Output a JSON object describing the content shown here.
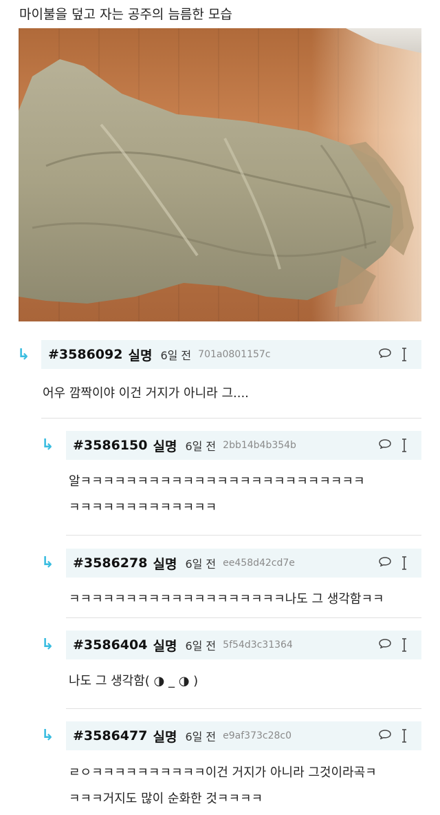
{
  "post": {
    "title": "마이불을 덮고 자는 공주의 늠름한 모습"
  },
  "comments": [
    {
      "number": "#3586092",
      "author": "실명",
      "time": "6일 전",
      "hash": "701a0801157c",
      "lines": [
        "어우 깜짝이야 이건 거지가 아니라 그...."
      ]
    },
    {
      "number": "#3586150",
      "author": "실명",
      "time": "6일 전",
      "hash": "2bb14b4b354b",
      "lines": [
        "알ㅋㅋㅋㅋㅋㅋㅋㅋㅋㅋㅋㅋㅋㅋㅋㅋㅋㅋㅋㅋㅋㅋㅋㅋㅋ",
        "ㅋㅋㅋㅋㅋㅋㅋㅋㅋㅋㅋㅋㅋ"
      ]
    },
    {
      "number": "#3586278",
      "author": "실명",
      "time": "6일 전",
      "hash": "ee458d42cd7e",
      "lines": [
        "ㅋㅋㅋㅋㅋㅋㅋㅋㅋㅋㅋㅋㅋㅋㅋㅋㅋㅋㅋ나도 그 생각함ㅋㅋ"
      ]
    },
    {
      "number": "#3586404",
      "author": "실명",
      "time": "6일 전",
      "hash": "5f54d3c31364",
      "lines": [
        "나도 그 생각함( ◑ _ ◑ )"
      ]
    },
    {
      "number": "#3586477",
      "author": "실명",
      "time": "6일 전",
      "hash": "e9af373c28c0",
      "lines": [
        "ㄹㅇㅋㅋㅋㅋㅋㅋㅋㅋㅋㅋ이건 거지가 아니라 그것이라곡ㅋ",
        "ㅋㅋㅋ거지도 많이 순화한 것ㅋㅋㅋㅋ"
      ]
    }
  ],
  "icons": {
    "reply": "reply-arrow-icon",
    "chat": "speech-bubble-icon",
    "more": "more-vertical-icon"
  },
  "colors": {
    "accent": "#3bbde0",
    "header_bg": "#eef6f8",
    "hash_text": "#8a8a8a"
  }
}
